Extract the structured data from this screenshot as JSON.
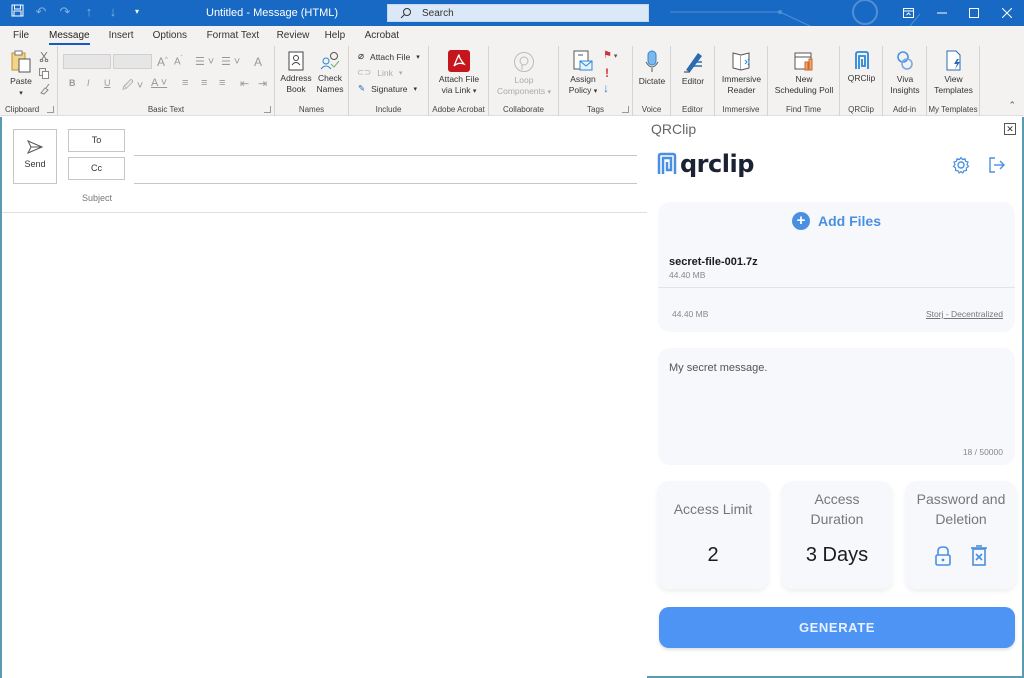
{
  "window": {
    "title": "Untitled  -  Message (HTML)",
    "search_placeholder": "Search",
    "controls": [
      "ribbon-display-options",
      "minimize",
      "maximize",
      "close"
    ]
  },
  "quick_access": {
    "icons": [
      "save-icon",
      "undo-icon",
      "redo-icon",
      "up-arrow-icon",
      "down-arrow-icon",
      "customize-icon"
    ]
  },
  "menu": {
    "tabs": [
      {
        "label": "File"
      },
      {
        "label": "Message",
        "active": true
      },
      {
        "label": "Insert"
      },
      {
        "label": "Options"
      },
      {
        "label": "Format Text"
      },
      {
        "label": "Review"
      },
      {
        "label": "Help"
      },
      {
        "label": "Acrobat"
      }
    ]
  },
  "ribbon": {
    "clipboard": {
      "paste": "Paste",
      "group": "Clipboard"
    },
    "basic_text": {
      "group": "Basic Text",
      "bold": "B",
      "italic": "I",
      "underline": "U"
    },
    "names": {
      "address_book": [
        "Address",
        "Book"
      ],
      "check_names": [
        "Check",
        "Names"
      ],
      "group": "Names"
    },
    "include": {
      "attach_file": "Attach File",
      "link": "Link",
      "signature": "Signature",
      "group": "Include"
    },
    "acrobat": {
      "attach_via_link": [
        "Attach File",
        "via Link"
      ],
      "group": "Adobe Acrobat"
    },
    "collaborate": {
      "loop": [
        "Loop",
        "Components"
      ],
      "group": "Collaborate"
    },
    "tags": {
      "assign_policy": [
        "Assign",
        "Policy"
      ],
      "group": "Tags"
    },
    "voice": {
      "dictate": "Dictate",
      "group": "Voice"
    },
    "editor": {
      "editor": "Editor",
      "group": "Editor"
    },
    "immersive": {
      "reader": [
        "Immersive",
        "Reader"
      ],
      "group": "Immersive"
    },
    "find_time": {
      "poll": [
        "New",
        "Scheduling Poll"
      ],
      "group": "Find Time"
    },
    "qrclip": {
      "button": "QRClip",
      "group": "QRClip"
    },
    "addin": {
      "viva": [
        "Viva",
        "Insights"
      ],
      "group": "Add-in"
    },
    "templates": {
      "view": [
        "View",
        "Templates"
      ],
      "group": "My Templates"
    }
  },
  "compose": {
    "send": "Send",
    "to": "To",
    "cc": "Cc",
    "subject": "Subject",
    "to_value": "",
    "cc_value": "",
    "subject_value": ""
  },
  "qrclip_pane": {
    "title": "QRClip",
    "logo_text": "qrclip",
    "add_files": "Add Files",
    "files": [
      {
        "name": "secret-file-001.7z",
        "size": "44.40 MB"
      }
    ],
    "total_size": "44.40 MB",
    "storage": "Storj - Decentralized",
    "message": "My secret message.",
    "char_count": "18 / 50000",
    "options": {
      "access_limit": {
        "label": "Access Limit",
        "value": "2"
      },
      "access_duration": {
        "label_1": "Access",
        "label_2": "Duration",
        "value": "3 Days"
      },
      "password_deletion": {
        "label_1": "Password and",
        "label_2": "Deletion"
      }
    },
    "generate": "GENERATE",
    "accent_color": "#4d94f5"
  }
}
